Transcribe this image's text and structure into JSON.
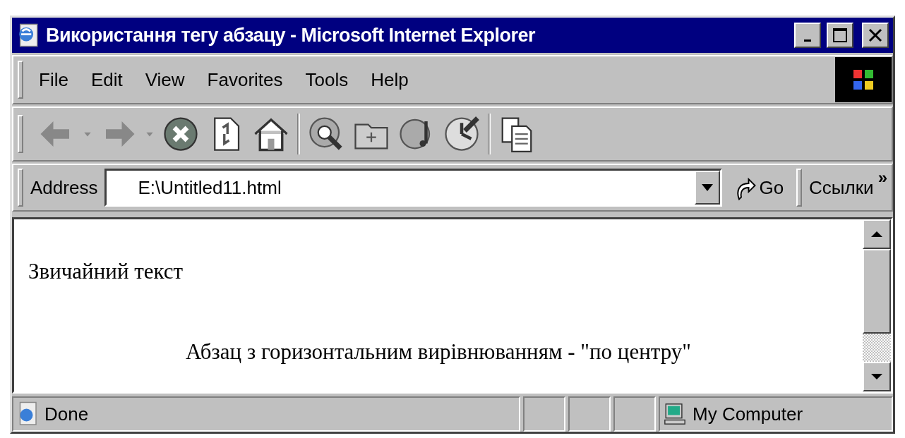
{
  "window": {
    "title": "Використання тегу абзацу - Microsoft Internet Explorer"
  },
  "menu": [
    "File",
    "Edit",
    "View",
    "Favorites",
    "Tools",
    "Help"
  ],
  "address": {
    "label": "Address",
    "value": "E:\\Untitled11.html",
    "go": "Go",
    "links": "Ссылки",
    "more": "»"
  },
  "content": [
    {
      "text": "Звичайний текст",
      "centered": false
    },
    {
      "text": "Абзац з горизонтальним вирівнюванням - \"по центру\"",
      "centered": true
    }
  ],
  "status_bar": {
    "text": "Done",
    "zone": "My Computer"
  }
}
